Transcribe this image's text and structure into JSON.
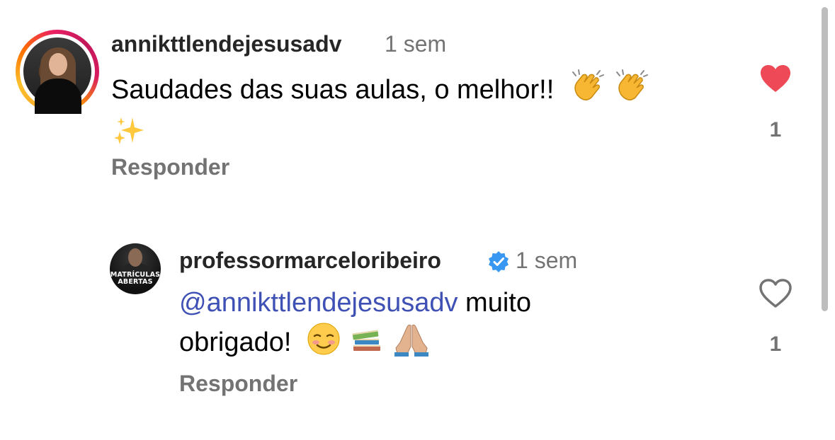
{
  "comments": [
    {
      "username": "annikttlendejesusadv",
      "time": "1 sem",
      "text_line1": "Saudades das suas aulas, o melhor!!",
      "emojis_line1": [
        "clapping-hands",
        "clapping-hands"
      ],
      "emojis_line2": [
        "sparkles"
      ],
      "reply_label": "Responder",
      "liked": true,
      "like_count": "1",
      "heart_color": "#ed4956",
      "avatar_ring_colors": [
        "#f9a825",
        "#e91e63",
        "#d81b60"
      ]
    },
    {
      "username": "professormarceloribeiro",
      "verified": true,
      "verified_color": "#3897f0",
      "time": "1 sem",
      "mention": "@annikttlendejesusadv",
      "text_line1_rest": " muito",
      "text_line2": "obrigado!",
      "emojis_line2": [
        "smiling-face",
        "books",
        "folded-hands"
      ],
      "avatar_text": [
        "MATRÍCULAS",
        "ABERTAS"
      ],
      "reply_label": "Responder",
      "liked": false,
      "like_count": "1"
    }
  ],
  "colors": {
    "mention": "#3f51b5",
    "secondary_text": "#737373"
  }
}
